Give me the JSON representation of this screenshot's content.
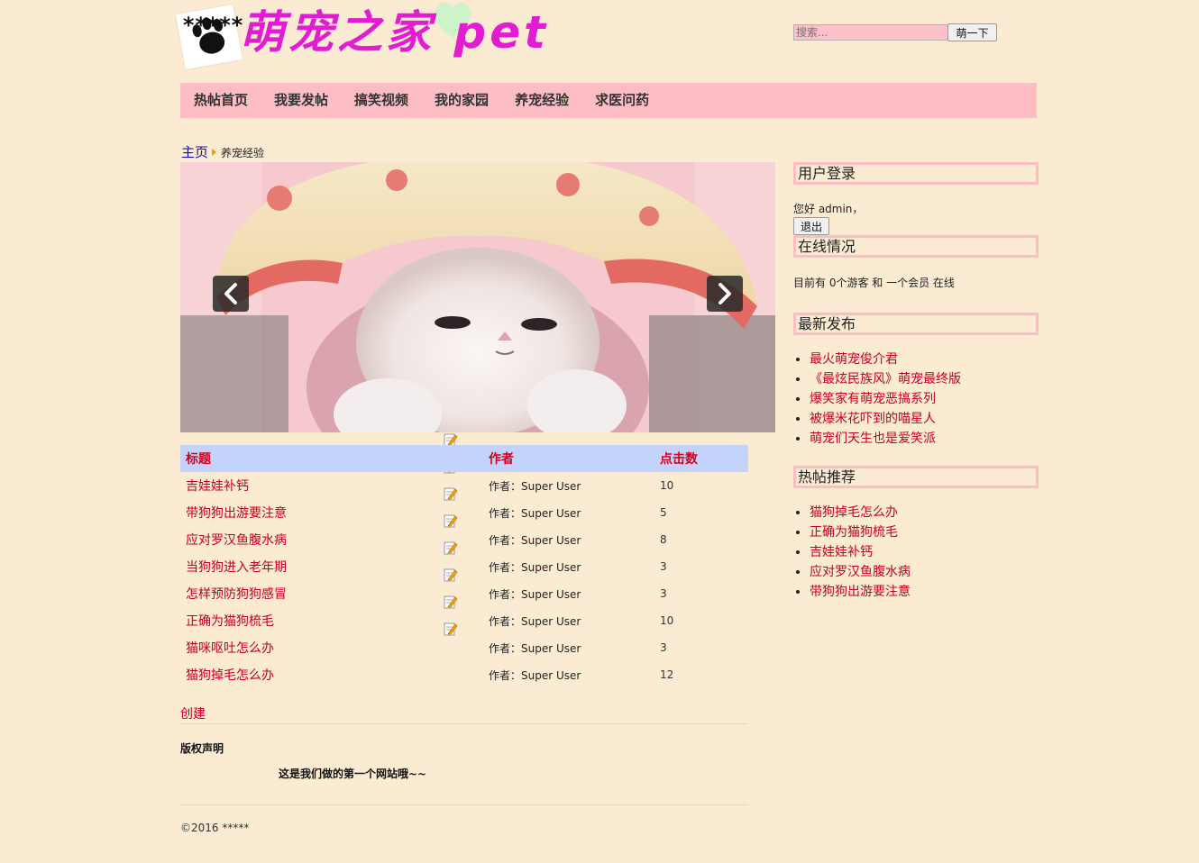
{
  "header": {
    "logo_text": "萌宠之家 pet",
    "logo_stars": "*****"
  },
  "search": {
    "placeholder": "搜索...",
    "button_label": "萌一下"
  },
  "nav": {
    "items": [
      "热帖首页",
      "我要发帖",
      "搞笑视频",
      "我的家园",
      "养宠经验",
      "求医问药"
    ]
  },
  "breadcrumb": {
    "home": "主页",
    "current": "养宠经验"
  },
  "slider": {
    "prev_icon": "chevron-left-icon",
    "next_icon": "chevron-right-icon"
  },
  "articles": {
    "headers": {
      "title": "标题",
      "author": "作者",
      "hits": "点击数"
    },
    "rows": [
      {
        "title": "吉娃娃补钙",
        "author": "作者：Super User",
        "hits": "10"
      },
      {
        "title": "带狗狗出游要注意",
        "author": "作者：Super User",
        "hits": "5"
      },
      {
        "title": "应对罗汉鱼腹水病",
        "author": "作者：Super User",
        "hits": "8"
      },
      {
        "title": "当狗狗进入老年期",
        "author": "作者：Super User",
        "hits": "3"
      },
      {
        "title": "怎样预防狗狗感冒",
        "author": "作者：Super User",
        "hits": "3"
      },
      {
        "title": "正确为猫狗梳毛",
        "author": "作者：Super User",
        "hits": "10"
      },
      {
        "title": "猫咪呕吐怎么办",
        "author": "作者：Super User",
        "hits": "3"
      },
      {
        "title": "猫狗掉毛怎么办",
        "author": "作者：Super User",
        "hits": "12"
      }
    ],
    "create_label": "创建"
  },
  "copyright": {
    "title": "版权声明",
    "text": "这是我们做的第一个网站哦~~"
  },
  "footer": {
    "text": "©2016 *****"
  },
  "sidebar": {
    "login": {
      "title": "用户登录",
      "greeting": "您好 admin，",
      "logout_label": "退出"
    },
    "online": {
      "title": "在线情况",
      "text": "目前有 0个游客 和 一个会员 在线"
    },
    "latest": {
      "title": "最新发布",
      "items": [
        "最火萌宠俊介君",
        "《最炫民族风》萌宠最终版",
        "爆笑家有萌宠恶搞系列",
        "被爆米花吓到的喵星人",
        "萌宠们天生也是爱笑派"
      ]
    },
    "hot": {
      "title": "热帖推荐",
      "items": [
        "猫狗掉毛怎么办",
        "正确为猫狗梳毛",
        "吉娃娃补钙",
        "应对罗汉鱼腹水病",
        "带狗狗出游要注意"
      ]
    }
  },
  "colors": {
    "background": "#fcebd3",
    "nav_bg": "#fdbdc5",
    "link_red": "#c5001a",
    "table_header_bg": "#c3d3fb",
    "logo_magenta": "#e21cd0"
  },
  "icons": {
    "edit": "edit-icon"
  }
}
